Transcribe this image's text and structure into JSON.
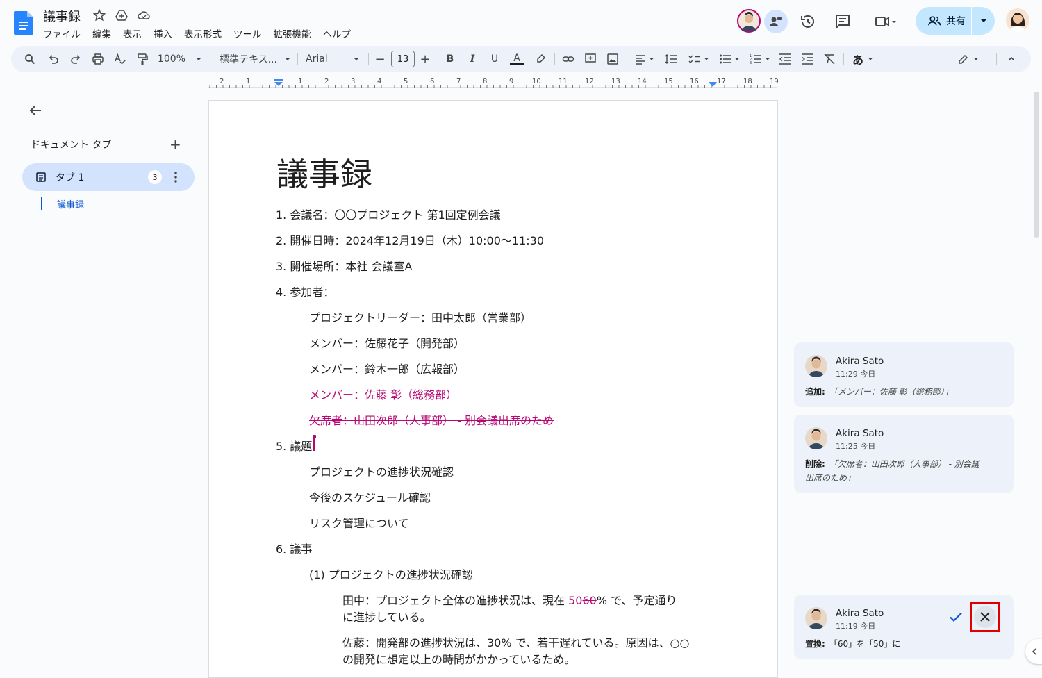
{
  "app": {
    "doc_title": "議事録",
    "menu": [
      "ファイル",
      "編集",
      "表示",
      "挿入",
      "表示形式",
      "ツール",
      "拡張機能",
      "ヘルプ"
    ],
    "share_label": "共有"
  },
  "toolbar": {
    "zoom": "100%",
    "style": "標準テキス...",
    "font": "Arial",
    "font_size": "13",
    "input_tool": "あ"
  },
  "ruler": [
    "2",
    "1",
    "1",
    "2",
    "3",
    "4",
    "5",
    "6",
    "7",
    "8",
    "9",
    "10",
    "11",
    "12",
    "13",
    "14",
    "15",
    "16",
    "17",
    "18",
    "19"
  ],
  "sidebar": {
    "heading": "ドキュメント タブ",
    "add": "+",
    "tab_label": "タブ 1",
    "tab_badge": "3",
    "outline_item": "議事録"
  },
  "document": {
    "title": "議事録",
    "lines": [
      "1. 会議名：〇〇プロジェクト 第1回定例会議",
      "2. 開催日時：2024年12月19日（木）10:00〜11:30",
      "3. 開催場所：本社 会議室A",
      "4. 参加者：",
      "プロジェクトリーダー：田中太郎（営業部）",
      "メンバー：佐藤花子（開発部）",
      "メンバー：鈴木一郎（広報部）",
      "メンバー：佐藤 彰（総務部）",
      "欠席者：山田次郎（人事部） - 別会議出席のため",
      "5. 議題",
      "プロジェクトの進捗状況確認",
      "今後のスケジュール確認",
      "リスク管理について",
      "6. 議事",
      "(1) プロジェクトの進捗状況確認"
    ],
    "para1_prefix": "田中：プロジェクト全体の進捗状況は、現在 ",
    "para1_ins": "50",
    "para1_del": "60",
    "para1_suffix": "% で、予定通り",
    "para1_line2": "に進捗している。",
    "para2_line1": "佐藤：開発部の進捗状況は、30% で、若干遅れている。原因は、○○",
    "para2_line2": "の開発に想定以上の時間がかかっているため。"
  },
  "suggestions": [
    {
      "name": "Akira Sato",
      "time": "11:29 今日",
      "action": "追加:",
      "detail": "「メンバー：佐藤 彰（総務部）」"
    },
    {
      "name": "Akira Sato",
      "time": "11:25 今日",
      "action": "削除:",
      "detail": "「欠席者：山田次郎（人事部） - 別会議",
      "detail2": "出席のため」"
    },
    {
      "name": "Akira Sato",
      "time": "11:19 今日",
      "action": "置換:",
      "detail": "「60」を「50」に"
    }
  ],
  "colors": {
    "suggestion": "#b80672",
    "accent": "#0b57d0",
    "share_bg": "#c2e7ff",
    "highlight_box": "#e00000"
  }
}
